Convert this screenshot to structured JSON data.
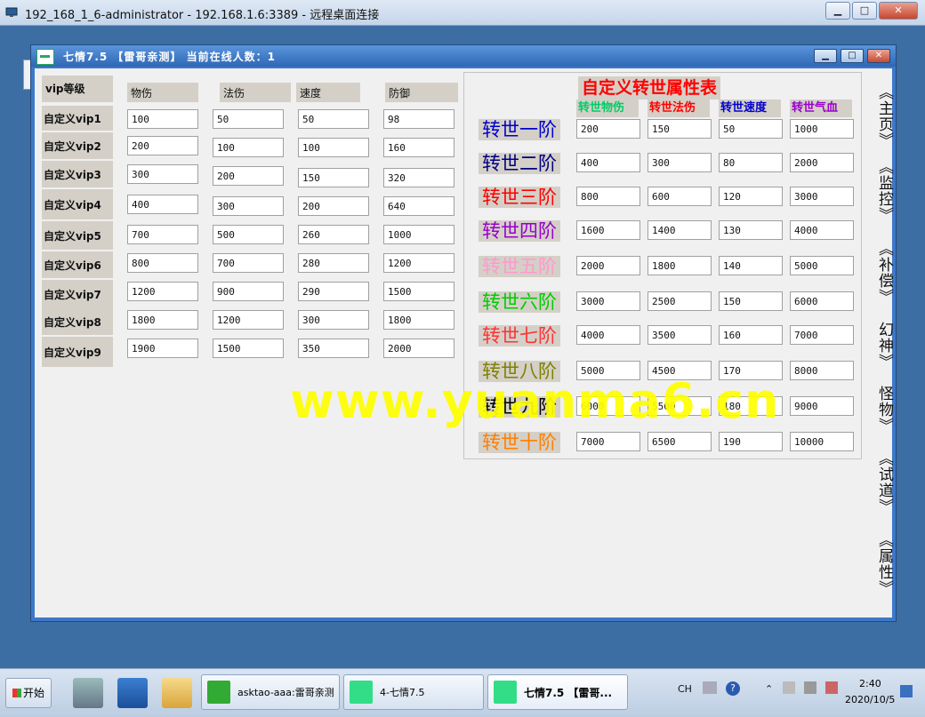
{
  "rdp": {
    "title": "192_168_1_6-administrator - 192.168.1.6:3389 - 远程桌面连接",
    "min": "▁",
    "max": "□",
    "close": "✕"
  },
  "app": {
    "title": "七情7.5 【雷哥亲测】 当前在线人数：1",
    "min": "▁",
    "max": "□",
    "close": "✕"
  },
  "vip_table": {
    "corner_header": "vip等级",
    "columns": [
      "物伤",
      "法伤",
      "速度",
      "防御"
    ],
    "rows": [
      {
        "label": "自定义vip1",
        "values": [
          "100",
          "50",
          "50",
          "98"
        ]
      },
      {
        "label": "自定义vip2",
        "values": [
          "200",
          "100",
          "100",
          "160"
        ]
      },
      {
        "label": "自定义vip3",
        "values": [
          "300",
          "200",
          "150",
          "320"
        ]
      },
      {
        "label": "自定义vip4",
        "values": [
          "400",
          "300",
          "200",
          "640"
        ]
      },
      {
        "label": "自定义vip5",
        "values": [
          "700",
          "500",
          "260",
          "1000"
        ]
      },
      {
        "label": "自定义vip6",
        "values": [
          "800",
          "700",
          "280",
          "1200"
        ]
      },
      {
        "label": "自定义vip7",
        "values": [
          "1200",
          "900",
          "290",
          "1500"
        ]
      },
      {
        "label": "自定义vip8",
        "values": [
          "1800",
          "1200",
          "300",
          "1800"
        ]
      },
      {
        "label": "自定义vip9",
        "values": [
          "1900",
          "1500",
          "350",
          "2000"
        ]
      }
    ]
  },
  "rebirth": {
    "title": "自定义转世属性表",
    "columns": [
      {
        "label": "转世物伤",
        "color": "#00cc66"
      },
      {
        "label": "转世法伤",
        "color": "#ff0000"
      },
      {
        "label": "转世速度",
        "color": "#0000cc"
      },
      {
        "label": "转世气血",
        "color": "#9900cc"
      }
    ],
    "rows": [
      {
        "label": "转世一阶",
        "color": "#0000cc",
        "values": [
          "200",
          "150",
          "50",
          "1000"
        ]
      },
      {
        "label": "转世二阶",
        "color": "#000080",
        "values": [
          "400",
          "300",
          "80",
          "2000"
        ]
      },
      {
        "label": "转世三阶",
        "color": "#ff0000",
        "values": [
          "800",
          "600",
          "120",
          "3000"
        ]
      },
      {
        "label": "转世四阶",
        "color": "#9900cc",
        "values": [
          "1600",
          "1400",
          "130",
          "4000"
        ]
      },
      {
        "label": "转世五阶",
        "color": "#ff99cc",
        "values": [
          "2000",
          "1800",
          "140",
          "5000"
        ]
      },
      {
        "label": "转世六阶",
        "color": "#00cc00",
        "values": [
          "3000",
          "2500",
          "150",
          "6000"
        ]
      },
      {
        "label": "转世七阶",
        "color": "#ff3333",
        "values": [
          "4000",
          "3500",
          "160",
          "7000"
        ]
      },
      {
        "label": "转世八阶",
        "color": "#808000",
        "values": [
          "5000",
          "4500",
          "170",
          "8000"
        ]
      },
      {
        "label": "转世九阶",
        "color": "#000000",
        "values": [
          "6000",
          "5500",
          "180",
          "9000"
        ]
      },
      {
        "label": "转世十阶",
        "color": "#ff8000",
        "values": [
          "7000",
          "6500",
          "190",
          "10000"
        ]
      }
    ]
  },
  "nav": [
    "《主页》",
    "《监控》",
    "《补偿》",
    "幻神》",
    "怪物》",
    "《试道》",
    "《属性》"
  ],
  "watermark": "www.yuanma6.cn",
  "taskbar": {
    "start": "开始",
    "tasks": [
      "asktao-aaa:雷哥亲测",
      "4-七情7.5",
      "七情7.5 【雷哥..."
    ],
    "tray_lang": "CH",
    "time": "2:40",
    "date": "2020/10/5"
  }
}
